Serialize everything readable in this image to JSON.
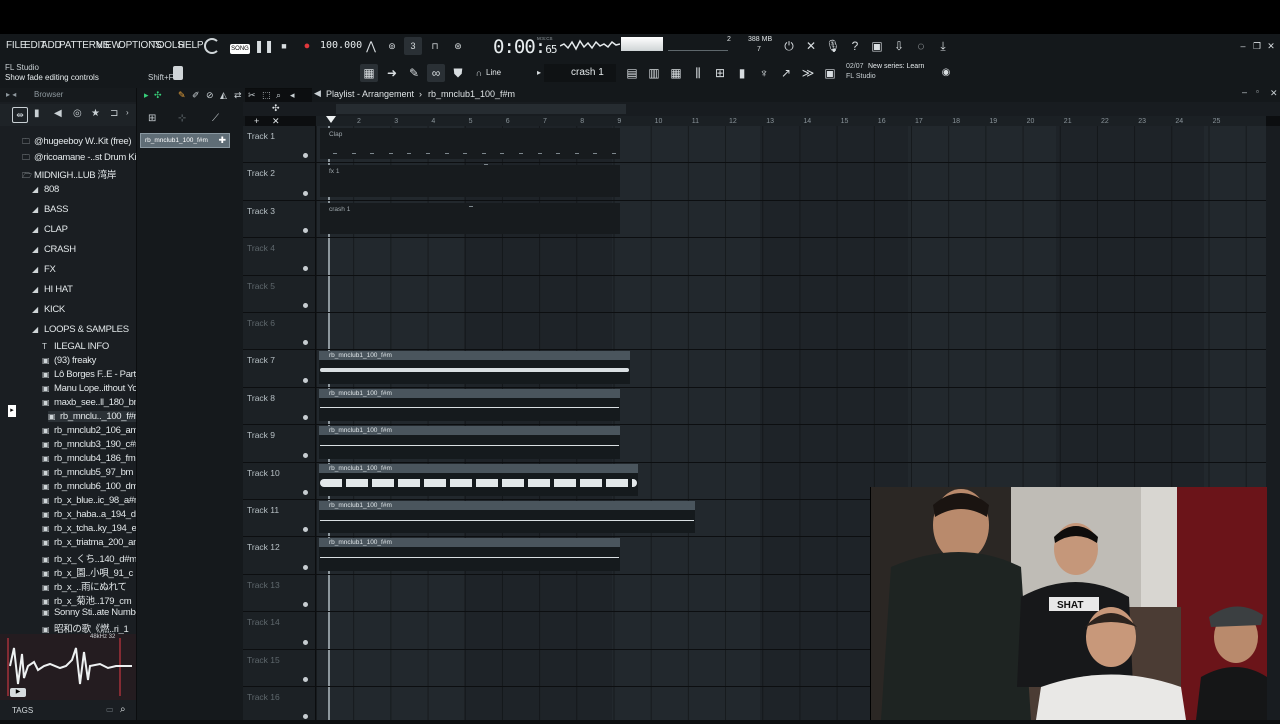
{
  "app": {
    "title": "FL Studio",
    "hint": "Show fade editing controls",
    "shortcut_label": "Shift+F",
    "song_mode": "SONG"
  },
  "menu": [
    "FILE",
    "EDIT",
    "ADD",
    "PATTERNS",
    "VIEW",
    "OPTIONS",
    "TOOLS",
    "HELP"
  ],
  "transport": {
    "tempo": "100.000",
    "time_main": "0:00:",
    "time_sub": "65",
    "time_unit": "M:S:CS",
    "memory": "388 MB",
    "cpu": "7",
    "counter": "2"
  },
  "tools": {
    "snap_label": "Line",
    "pattern_name": "crash 1",
    "news_date": "02/07",
    "news_text": "New series: Learn",
    "news_sub": "FL Studio"
  },
  "browser": {
    "header": "Browser",
    "items": [
      {
        "label": "@hugeeboy W..Kit (free)",
        "type": "folder"
      },
      {
        "label": "@ricoamane -..st Drum Kit",
        "type": "folder"
      },
      {
        "label": "MIDNIGH..LUB 湾岸",
        "type": "folder-open"
      },
      {
        "label": "808",
        "type": "sub"
      },
      {
        "label": "BASS",
        "type": "sub"
      },
      {
        "label": "CLAP",
        "type": "sub"
      },
      {
        "label": "CRASH",
        "type": "sub"
      },
      {
        "label": "FX",
        "type": "sub"
      },
      {
        "label": "HI HAT",
        "type": "sub"
      },
      {
        "label": "KICK",
        "type": "sub"
      },
      {
        "label": "LOOPS & SAMPLES",
        "type": "sub-open"
      },
      {
        "label": "ILEGAL INFO",
        "type": "text"
      },
      {
        "label": "(93) freaky",
        "type": "file"
      },
      {
        "label": "Lô Borges F..E - Part_1",
        "type": "file"
      },
      {
        "label": "Manu Lope..ithout You",
        "type": "file"
      },
      {
        "label": "maxb_see..ll_180_bm",
        "type": "file"
      },
      {
        "label": "rb_mnclu.._100_f#m",
        "type": "file-sel"
      },
      {
        "label": "rb_mnclub2_106_am",
        "type": "file"
      },
      {
        "label": "rb_mnclub3_190_c#m",
        "type": "file"
      },
      {
        "label": "rb_mnclub4_186_fm",
        "type": "file"
      },
      {
        "label": "rb_mnclub5_97_bm",
        "type": "file"
      },
      {
        "label": "rb_mnclub6_100_dm",
        "type": "file"
      },
      {
        "label": "rb_x_blue..ic_98_a#m",
        "type": "file"
      },
      {
        "label": "rb_x_haba..a_194_dm",
        "type": "file"
      },
      {
        "label": "rb_x_tcha..ky_194_em",
        "type": "file"
      },
      {
        "label": "rb_x_triatma_200_am",
        "type": "file"
      },
      {
        "label": "rb_x_くち..140_d#m",
        "type": "file"
      },
      {
        "label": "rb_x_園..小唄_91_c",
        "type": "file"
      },
      {
        "label": "rb_x_..雨にぬれて",
        "type": "file"
      },
      {
        "label": "rb_x_菊池..179_cm",
        "type": "file"
      },
      {
        "label": "Sonny Sti..ate Number",
        "type": "file"
      },
      {
        "label": "昭和の歌《燃..ri_1",
        "type": "file"
      }
    ],
    "preview_info": "48kHz 32",
    "tags_label": "TAGS"
  },
  "pattern_picker": {
    "selected": "rb_mnclub1_100_f#m"
  },
  "playlist": {
    "title": "Playlist - Arrangement",
    "crumb": "rb_mnclub1_100_f#m",
    "ruler": [
      "2",
      "3",
      "4",
      "5",
      "6",
      "7",
      "8",
      "9",
      "10",
      "11",
      "12",
      "13",
      "14",
      "15",
      "16",
      "17",
      "18",
      "19",
      "20",
      "21",
      "22",
      "23",
      "24",
      "25"
    ],
    "tracks": [
      {
        "name": "Track 1",
        "clip": "Clap",
        "kind": "pattern"
      },
      {
        "name": "Track 2",
        "clip": "fx 1",
        "kind": "pattern"
      },
      {
        "name": "Track 3",
        "clip": "crash 1",
        "kind": "pattern"
      },
      {
        "name": "Track 4",
        "clip": "",
        "kind": "empty"
      },
      {
        "name": "Track 5",
        "clip": "",
        "kind": "empty"
      },
      {
        "name": "Track 6",
        "clip": "",
        "kind": "empty"
      },
      {
        "name": "Track 7",
        "clip": "rb_mnclub1_100_f#m",
        "kind": "audio"
      },
      {
        "name": "Track 8",
        "clip": "rb_mnclub1_100_f#m",
        "kind": "audio"
      },
      {
        "name": "Track 9",
        "clip": "rb_mnclub1_100_f#m",
        "kind": "audio"
      },
      {
        "name": "Track 10",
        "clip": "rb_mnclub1_100_f#m",
        "kind": "audio"
      },
      {
        "name": "Track 11",
        "clip": "rb_mnclub1_100_f#m",
        "kind": "audio"
      },
      {
        "name": "Track 12",
        "clip": "rb_mnclub1_100_f#m",
        "kind": "audio"
      },
      {
        "name": "Track 13",
        "clip": "",
        "kind": "empty"
      },
      {
        "name": "Track 14",
        "clip": "",
        "kind": "empty"
      },
      {
        "name": "Track 15",
        "clip": "",
        "kind": "empty"
      },
      {
        "name": "Track 16",
        "clip": "",
        "kind": "empty"
      }
    ]
  },
  "webcam": {
    "shirt_text": "SHAT"
  }
}
